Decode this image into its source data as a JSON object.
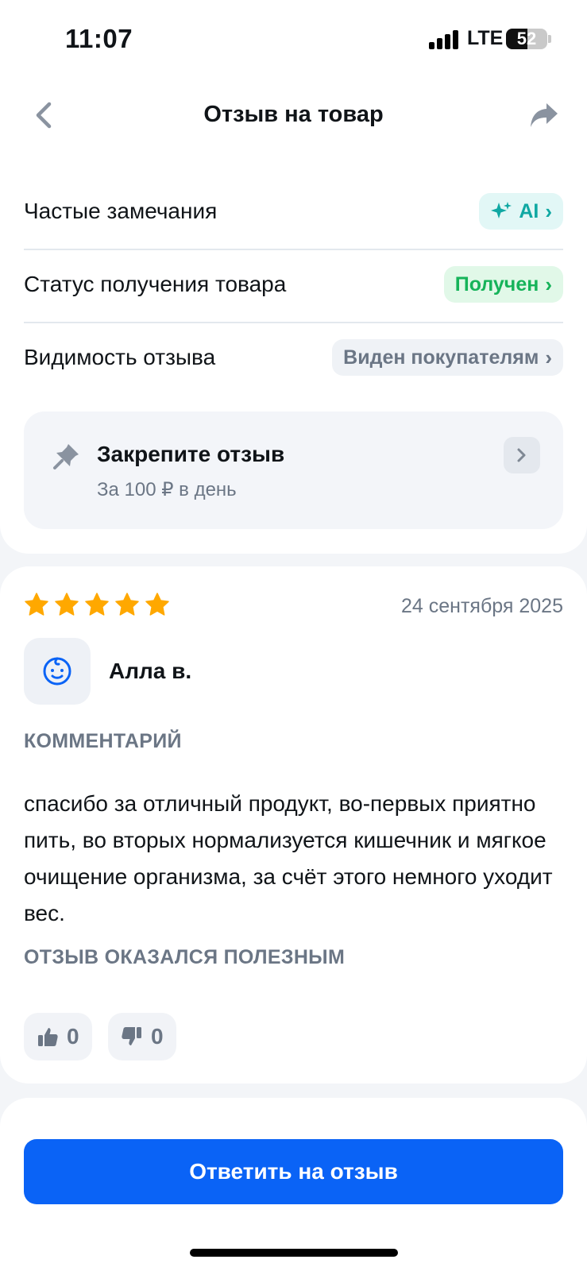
{
  "status_bar": {
    "time": "11:07",
    "network": "LTE",
    "battery": "52",
    "battery_level": 0.52
  },
  "nav": {
    "title": "Отзыв на товар"
  },
  "rows": [
    {
      "label": "Частые замечания",
      "value": "AI",
      "style": "ai",
      "icon": "sparkle-icon"
    },
    {
      "label": "Статус получения товара",
      "value": "Получен",
      "style": "green"
    },
    {
      "label": "Видимость отзыва",
      "value": "Виден покупателям",
      "style": "gray"
    }
  ],
  "pin": {
    "title": "Закрепите отзыв",
    "subtitle": "За 100 ₽ в день",
    "icon": "pin-icon"
  },
  "review": {
    "rating": 5,
    "date": "24 сентября 2025",
    "author": "Алла в.",
    "comment_label": "КОММЕНТАРИЙ",
    "comment": "спасибо за отличный продукт, во-первых приятно пить, во вторых нормализуется кишечник и мягкое очищение организма, за счёт этого немного уходит вес.",
    "helpful_label": "ОТЗЫВ ОКАЗАЛСЯ ПОЛЕЗНЫМ",
    "likes": "0",
    "dislikes": "0"
  },
  "actions": {
    "reply_label": "Ответить на отзыв"
  },
  "colors": {
    "accent": "#0a63f6",
    "star": "#ffa800",
    "ai": "#10a8a3",
    "success": "#16b35a",
    "muted": "#6b7685"
  }
}
